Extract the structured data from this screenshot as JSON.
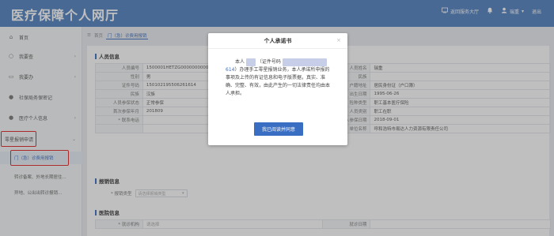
{
  "header": {
    "title": "医疗保障个人网厅",
    "return_label": "返回服务大厅",
    "user_label": "瑞重",
    "logout_label": "退出"
  },
  "sidebar": {
    "items": [
      {
        "label": "首页",
        "icon": "home-icon"
      },
      {
        "label": "我要查",
        "icon": "search-icon"
      },
      {
        "label": "我要办",
        "icon": "briefcase-icon"
      },
      {
        "label": "社保局务保密记",
        "icon": "user-icon"
      },
      {
        "label": "医疗个人信息",
        "icon": "user-icon"
      },
      {
        "label": "零星报销申请",
        "icon": ""
      }
    ],
    "subitems": [
      {
        "label": "门（急）诊费用报销"
      },
      {
        "label": "转诊备案、外地长期居住..."
      },
      {
        "label": "异地、公出出转诊报销..."
      }
    ]
  },
  "breadcrumb": {
    "home": "首页",
    "tab": "门（急）诊费用报销"
  },
  "sections": {
    "personal": "人员信息",
    "reimburse": "报销信息",
    "medical": "医院信息"
  },
  "info_table": [
    [
      "人员编号",
      "1500001HETZG00000000000",
      "人员姓名",
      "瑞重"
    ],
    [
      "性别",
      "男",
      "民族",
      ""
    ],
    [
      "证件号码",
      "150102195506261614",
      "户籍地址",
      "居民身份证（户口簿）"
    ],
    [
      "民族",
      "汉族",
      "出生日期",
      "1995-06-26"
    ],
    [
      "人员参保状态",
      "正常参保",
      "险种类型",
      "职工基本医疗保险"
    ],
    [
      "首次参保年月",
      "201809",
      "人员类别",
      "职工在职"
    ],
    [
      "* 联系电话",
      "",
      "个人参保日期",
      "2018-09-01"
    ],
    [
      "",
      "",
      "单位名称",
      "呼和浩特市易达人力资源有限责任公司"
    ]
  ],
  "reimburse": {
    "type_label": "* 报销类型",
    "type_placeholder": "请选择报销类型"
  },
  "medical_row": {
    "c1": "* 就诊机构",
    "c2": "请选择",
    "c3": "就诊日期",
    "c4": ""
  },
  "modal": {
    "title": "个人承诺书",
    "line_prefix": "本人",
    "id_label": "（证件号码",
    "id_suffix": "614",
    "text": "）办理手工零星报销业务，本人承诺所申报的事项及上传的有证信息和电子版票据，真实、准确、完整、有效，由此产生的一切法律责任均由本人承担。",
    "confirm_label": "我已阅读并同意"
  },
  "colors": {
    "brand": "#4f7fc0",
    "accent": "#3a6ec2",
    "highlight_box": "#e02020"
  }
}
